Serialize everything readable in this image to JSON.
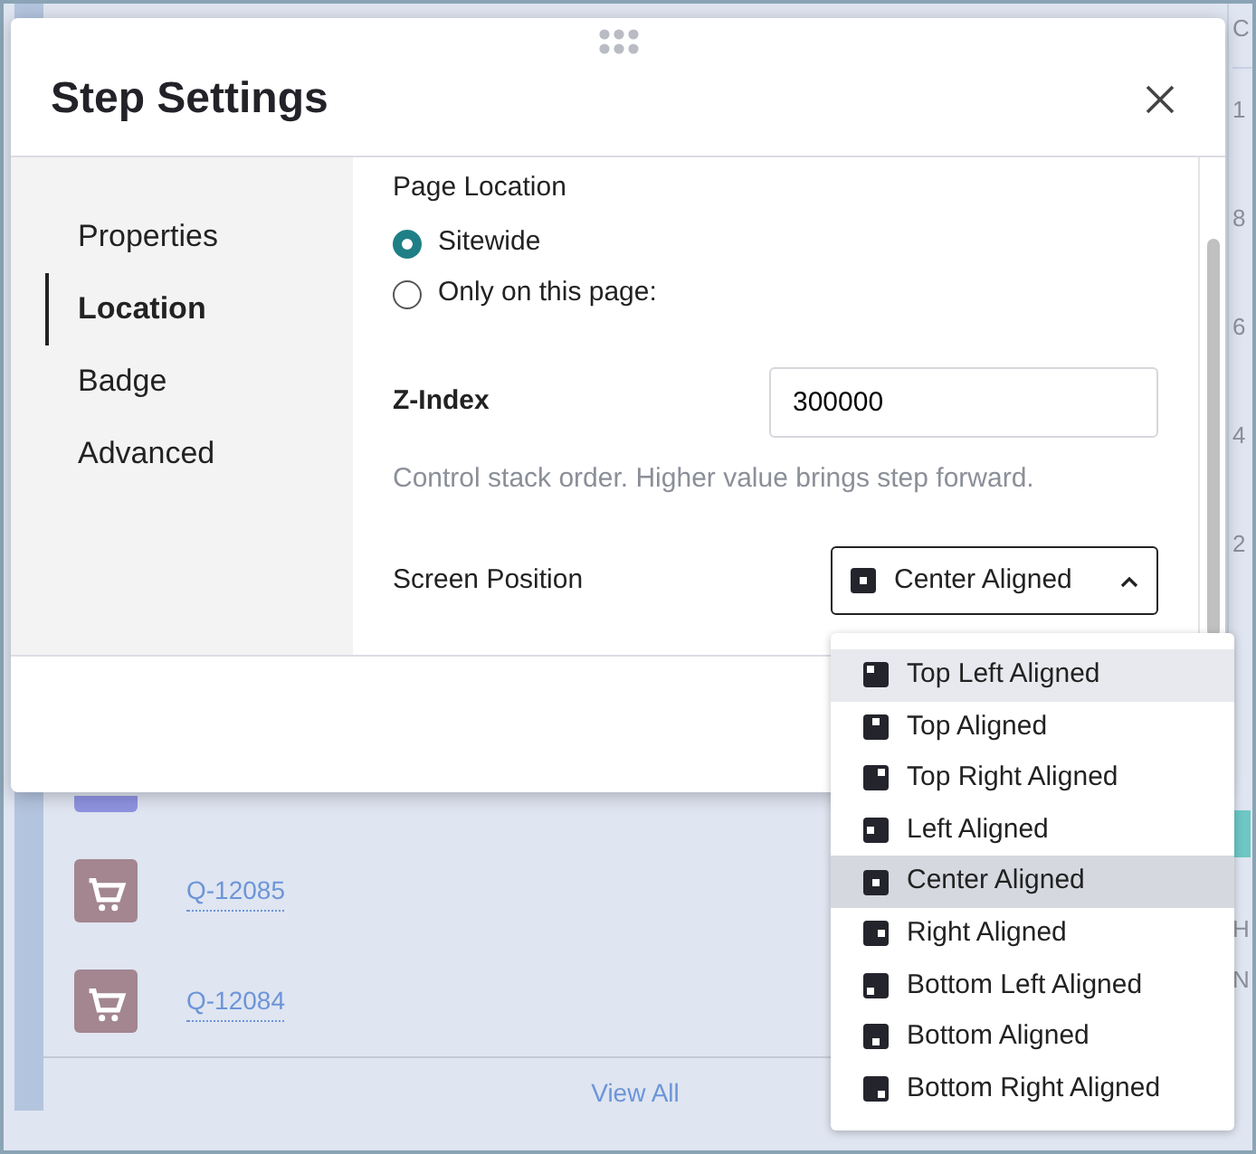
{
  "background": {
    "rows": [
      {
        "kind": "hidden",
        "color": "#8f93e0"
      },
      {
        "kind": "quote",
        "label": "Q-12085",
        "color": "#a3868f"
      },
      {
        "kind": "quote",
        "label": "Q-12084",
        "color": "#a3868f"
      }
    ],
    "view_all": "View All",
    "right_column": {
      "header": "C",
      "ticks": [
        "1",
        "8",
        "6",
        "4",
        "2"
      ],
      "labels": [
        "H",
        "N"
      ]
    }
  },
  "dialog": {
    "title": "Step Settings",
    "nav": [
      {
        "label": "Properties",
        "selected": false
      },
      {
        "label": "Location",
        "selected": true
      },
      {
        "label": "Badge",
        "selected": false
      },
      {
        "label": "Advanced",
        "selected": false
      }
    ],
    "page_location": {
      "label": "Page Location",
      "options": [
        {
          "label": "Sitewide",
          "selected": true
        },
        {
          "label": "Only on this page:",
          "selected": false
        }
      ]
    },
    "z_index": {
      "label": "Z-Index",
      "value": "300000",
      "help": "Control stack order. Higher value brings step forward."
    },
    "screen_position": {
      "label": "Screen Position",
      "value": "Center Aligned",
      "kind": "center",
      "expanded": true,
      "options": [
        {
          "label": "Top Left Aligned",
          "kind": "top-left",
          "selected": false,
          "hovered": true
        },
        {
          "label": "Top Aligned",
          "kind": "top",
          "selected": false,
          "hovered": false
        },
        {
          "label": "Top Right Aligned",
          "kind": "top-right",
          "selected": false,
          "hovered": false
        },
        {
          "label": "Left Aligned",
          "kind": "left",
          "selected": false,
          "hovered": false
        },
        {
          "label": "Center Aligned",
          "kind": "center",
          "selected": true,
          "hovered": false
        },
        {
          "label": "Right Aligned",
          "kind": "right",
          "selected": false,
          "hovered": false
        },
        {
          "label": "Bottom Left Aligned",
          "kind": "bottom-left",
          "selected": false,
          "hovered": false
        },
        {
          "label": "Bottom Aligned",
          "kind": "bottom",
          "selected": false,
          "hovered": false
        },
        {
          "label": "Bottom Right Aligned",
          "kind": "bottom-right",
          "selected": false,
          "hovered": false
        }
      ]
    }
  }
}
